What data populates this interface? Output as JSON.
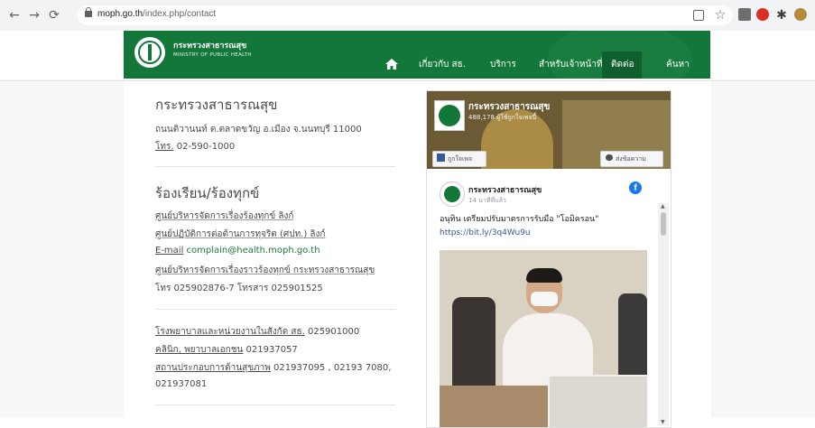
{
  "browser": {
    "url_domain": "moph.go.th",
    "url_path": "/index.php/contact"
  },
  "site": {
    "brand_th": "กระทรวงสาธารณสุข",
    "brand_en": "MINISTRY OF PUBLIC HEALTH",
    "nav": [
      "เกี่ยวกับ สธ.",
      "บริการ",
      "สำหรับเจ้าหน้าที่",
      "ติดต่อ",
      "ค้นหา"
    ]
  },
  "contact": {
    "title": "กระทรวงสาธารณสุข",
    "address": "ถนนติวานนท์ ต.ตลาดขวัญ อ.เมือง จ.นนทบุรี 11000",
    "phone_label": "โทร.",
    "phone": "02-590-1000"
  },
  "complaints": {
    "title": "ร้องเรียน/ร้องทุกข์",
    "lines": [
      "ศูนย์บริหารจัดการเรื่องร้องทุกข์ ลิงก์",
      "ศูนย์ปฏิบัติการต่อต้านการทุจริต (ศปท.) ลิงก์",
      "E-mail",
      "complain@health.moph.go.th",
      "ศูนย์บริหารจัดการเรื่องราวร้องทุกข์ กระทรวงสาธารณสุข",
      "โทร 025902876-7 โทรสาร 025901525"
    ]
  },
  "other": {
    "lines": [
      "โรงพยาบาลและหน่วยงานในสังกัด สธ.",
      "025901000",
      "คลินิก, พยาบาลเอกชน",
      "021937057",
      "สถานประกอบการด้านสุขภาพ",
      "021937095 , 02193 7080,",
      "021937081"
    ]
  },
  "facebook": {
    "page_name": "กระทรวงสาธารณสุข",
    "likes": "488,178 ผู้ใช้ถูกใจเพจนี้",
    "like_button": "ถูกใจเพจ",
    "message_button": "ส่งข้อความ",
    "post_author": "กระทรวงสาธารณสุข",
    "post_time": "14 นาทีที่แล้ว",
    "post_text": "อนุทิน เตรียมปรับมาตรการรับมือ \"โอมิครอน\"",
    "post_link": "https://bit.ly/3q4Wu9u"
  }
}
